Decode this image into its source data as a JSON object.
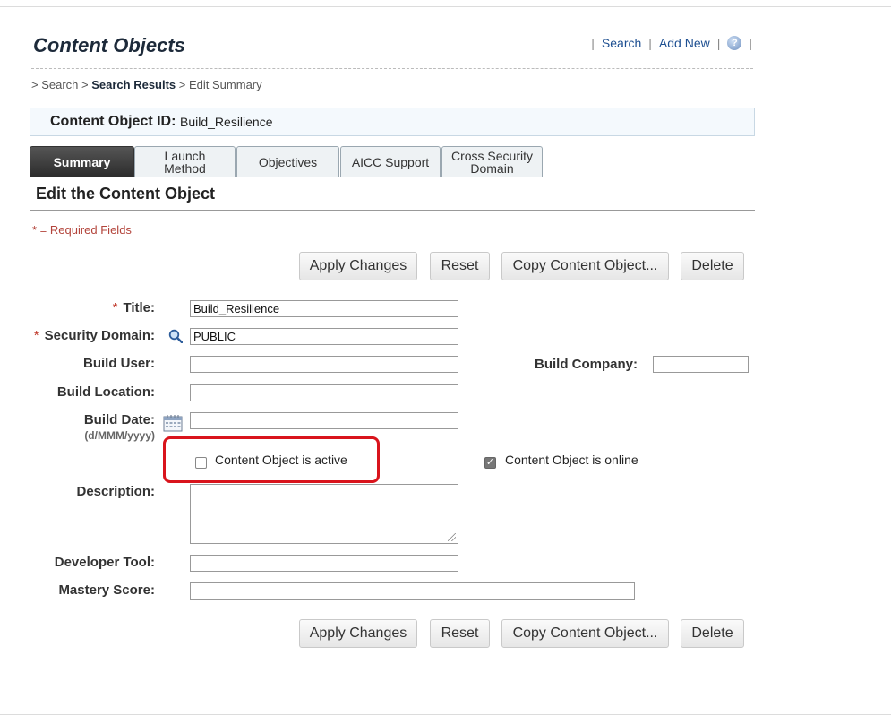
{
  "header": {
    "title": "Content Objects",
    "links": {
      "search": "Search",
      "add_new": "Add New",
      "help": "?"
    }
  },
  "breadcrumb": {
    "prefix1": "> Search >",
    "current": "Search Results",
    "prefix2": "> Edit Summary"
  },
  "id_box": {
    "label": "Content Object ID:",
    "value": "Build_Resilience"
  },
  "tabs": [
    {
      "line1": "Summary",
      "line2": "",
      "active": true
    },
    {
      "line1": "Launch",
      "line2": "Method",
      "active": false
    },
    {
      "line1": "Objectives",
      "line2": "",
      "active": false
    },
    {
      "line1": "AICC Support",
      "line2": "",
      "active": false
    },
    {
      "line1": "Cross Security",
      "line2": "Domain",
      "active": false
    }
  ],
  "section_title": "Edit the Content Object",
  "required_note": "* = Required Fields",
  "buttons": {
    "apply": "Apply Changes",
    "reset": "Reset",
    "copy": "Copy Content Object...",
    "delete": "Delete"
  },
  "form": {
    "title_label": "Title:",
    "title_value": "Build_Resilience",
    "security_domain_label": "Security Domain:",
    "security_domain_value": "PUBLIC",
    "build_user_label": "Build User:",
    "build_user_value": "",
    "build_company_label": "Build Company:",
    "build_company_value": "",
    "build_location_label": "Build Location:",
    "build_location_value": "",
    "build_date_label": "Build Date:",
    "build_date_format": "(d/MMM/yyyy)",
    "build_date_value": "",
    "active_label": "Content Object is active",
    "active_checked": false,
    "online_label": "Content Object is online",
    "online_checked": true,
    "description_label": "Description:",
    "description_value": "",
    "developer_tool_label": "Developer Tool:",
    "developer_tool_value": "",
    "mastery_score_label": "Mastery Score:",
    "mastery_score_value": ""
  },
  "colors": {
    "highlight": "#d9141c",
    "link": "#1d4f91",
    "required": "#b3443b"
  }
}
